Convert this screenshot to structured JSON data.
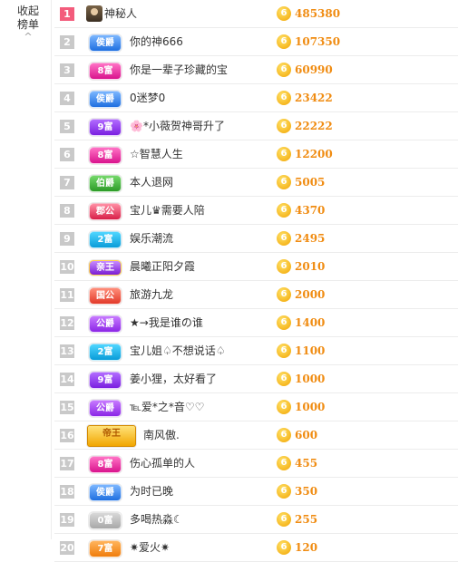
{
  "collapse": {
    "line1": "收起",
    "line2": "榜单",
    "caret": "^"
  },
  "colors": {
    "accent": "#f08c12",
    "rank_top": "#f35c7c",
    "rank_default": "#c9c9c9"
  },
  "coin_symbol": "6",
  "rows": [
    {
      "rank": "1",
      "badge": null,
      "badge_class": "avatar",
      "name": "神秘人",
      "score": "485380"
    },
    {
      "rank": "2",
      "badge": "侯爵",
      "badge_class": "hou",
      "name": "你的神666",
      "score": "107350"
    },
    {
      "rank": "3",
      "badge": "8富",
      "badge_class": "fu8",
      "name": "你是一辈子珍藏的宝",
      "score": "60990"
    },
    {
      "rank": "4",
      "badge": "侯爵",
      "badge_class": "hou",
      "name": "0迷梦0",
      "score": "23422"
    },
    {
      "rank": "5",
      "badge": "9富",
      "badge_class": "fu9",
      "name": "🌸*小薇贺神哥升了",
      "score": "22222"
    },
    {
      "rank": "6",
      "badge": "8富",
      "badge_class": "fu8",
      "name": "☆智慧人生",
      "score": "12200"
    },
    {
      "rank": "7",
      "badge": "伯爵",
      "badge_class": "bo",
      "name": "本人退网",
      "score": "5005"
    },
    {
      "rank": "8",
      "badge": "郡公",
      "badge_class": "jungong",
      "name": "宝儿♛需要人陪",
      "score": "4370"
    },
    {
      "rank": "9",
      "badge": "2富",
      "badge_class": "fu2",
      "name": "娱乐潮流",
      "score": "2495"
    },
    {
      "rank": "10",
      "badge": "亲王",
      "badge_class": "qinwang",
      "name": "晨曦正阳夕霞",
      "score": "2010"
    },
    {
      "rank": "11",
      "badge": "国公",
      "badge_class": "guogong",
      "name": "旅游九龙",
      "score": "2000"
    },
    {
      "rank": "12",
      "badge": "公爵",
      "badge_class": "gongjue",
      "name": "★→我是谁の谁",
      "score": "1400"
    },
    {
      "rank": "13",
      "badge": "2富",
      "badge_class": "fu2",
      "name": "宝儿姐♤不想说话♤",
      "score": "1100"
    },
    {
      "rank": "14",
      "badge": "9富",
      "badge_class": "fu9",
      "name": "姜小狸，太好看了",
      "score": "1000"
    },
    {
      "rank": "15",
      "badge": "公爵",
      "badge_class": "gongjue",
      "name": "℡爱*之*音♡♡",
      "score": "1000"
    },
    {
      "rank": "16",
      "badge": "帝王",
      "badge_class": "king",
      "name": "南风傲.",
      "score": "600"
    },
    {
      "rank": "17",
      "badge": "8富",
      "badge_class": "fu8",
      "name": "伤心孤单的人",
      "score": "455"
    },
    {
      "rank": "18",
      "badge": "侯爵",
      "badge_class": "hou",
      "name": "为时已晚",
      "score": "350"
    },
    {
      "rank": "19",
      "badge": "0富",
      "badge_class": "fu0",
      "name": "多喝热淼☾",
      "score": "255"
    },
    {
      "rank": "20",
      "badge": "7富",
      "badge_class": "fu7",
      "name": "✷爱火✷",
      "score": "120"
    }
  ]
}
